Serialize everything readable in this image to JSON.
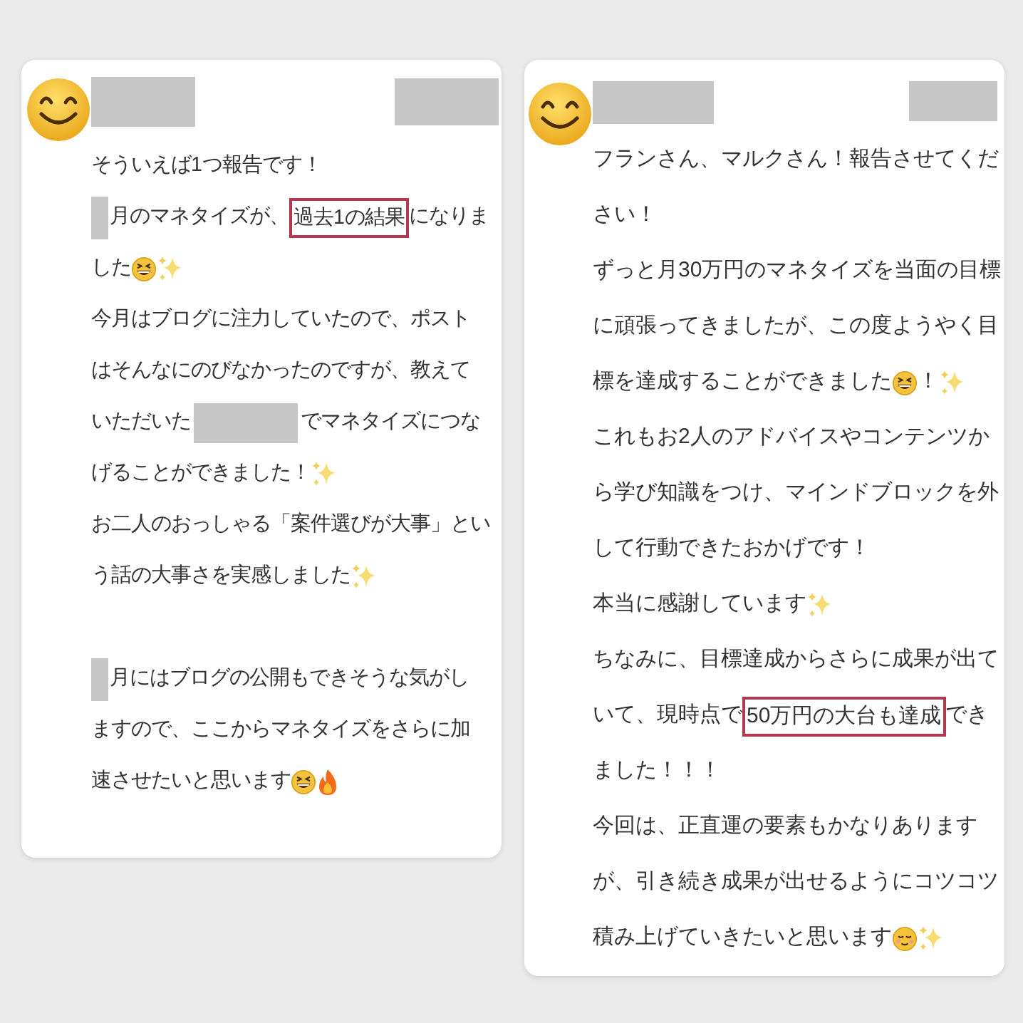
{
  "cards": [
    {
      "lines": [
        {
          "kind": "line",
          "segments": [
            {
              "kind": "text",
              "text": "そういえば1つ報告です！"
            }
          ]
        },
        {
          "kind": "line",
          "segments": [
            {
              "kind": "redaction"
            },
            {
              "kind": "text",
              "text": "月のマネタイズが、"
            },
            {
              "kind": "highlight",
              "text": "過去1の結果"
            },
            {
              "kind": "text",
              "text": "になりま"
            }
          ]
        },
        {
          "kind": "line",
          "segments": [
            {
              "kind": "text",
              "text": "した"
            },
            {
              "kind": "grin"
            },
            {
              "kind": "sparkles"
            }
          ]
        },
        {
          "kind": "line",
          "segments": [
            {
              "kind": "text",
              "text": "今月はブログに注力していたので、ポスト"
            }
          ]
        },
        {
          "kind": "line",
          "segments": [
            {
              "kind": "text",
              "text": "はそんなにのびなかったのですが、教えて"
            }
          ]
        },
        {
          "kind": "line",
          "segments": [
            {
              "kind": "text",
              "text": "いただいた"
            },
            {
              "kind": "redaction"
            },
            {
              "kind": "text",
              "text": "でマネタイズにつな"
            }
          ]
        },
        {
          "kind": "line",
          "segments": [
            {
              "kind": "text",
              "text": "げることができました！"
            },
            {
              "kind": "sparkles"
            }
          ]
        },
        {
          "kind": "line",
          "segments": [
            {
              "kind": "text",
              "text": "お二人のおっしゃる「案件選びが大事」とい"
            }
          ]
        },
        {
          "kind": "line",
          "segments": [
            {
              "kind": "text",
              "text": "う話の大事さを実感しました"
            },
            {
              "kind": "sparkles"
            }
          ]
        },
        {
          "kind": "blank"
        },
        {
          "kind": "line",
          "segments": [
            {
              "kind": "redaction"
            },
            {
              "kind": "text",
              "text": "月にはブログの公開もできそうな気がし"
            }
          ]
        },
        {
          "kind": "line",
          "segments": [
            {
              "kind": "text",
              "text": "ますので、ここからマネタイズをさらに加"
            }
          ]
        },
        {
          "kind": "line",
          "segments": [
            {
              "kind": "text",
              "text": "速させたいと思います"
            },
            {
              "kind": "grin"
            },
            {
              "kind": "fire"
            }
          ]
        }
      ]
    },
    {
      "lines": [
        {
          "kind": "line",
          "segments": [
            {
              "kind": "text",
              "text": "フランさん、マルクさん！報告させてくだ"
            }
          ]
        },
        {
          "kind": "line",
          "segments": [
            {
              "kind": "text",
              "text": "さい！"
            }
          ]
        },
        {
          "kind": "line",
          "segments": [
            {
              "kind": "text",
              "text": "ずっと月30万円のマネタイズを当面の目標"
            }
          ]
        },
        {
          "kind": "line",
          "segments": [
            {
              "kind": "text",
              "text": "に頑張ってきましたが、この度ようやく目"
            }
          ]
        },
        {
          "kind": "line",
          "segments": [
            {
              "kind": "text",
              "text": "標を達成することができました"
            },
            {
              "kind": "grin"
            },
            {
              "kind": "text",
              "text": "！"
            },
            {
              "kind": "sparkles"
            }
          ]
        },
        {
          "kind": "line",
          "segments": [
            {
              "kind": "text",
              "text": "これもお2人のアドバイスやコンテンツか"
            }
          ]
        },
        {
          "kind": "line",
          "segments": [
            {
              "kind": "text",
              "text": "ら学び知識をつけ、マインドブロックを外"
            }
          ]
        },
        {
          "kind": "line",
          "segments": [
            {
              "kind": "text",
              "text": "して行動できたおかげです！"
            }
          ]
        },
        {
          "kind": "line",
          "segments": [
            {
              "kind": "text",
              "text": "本当に感謝しています"
            },
            {
              "kind": "sparkles"
            }
          ]
        },
        {
          "kind": "line",
          "segments": [
            {
              "kind": "text",
              "text": "ちなみに、目標達成からさらに成果が出て"
            }
          ]
        },
        {
          "kind": "line",
          "segments": [
            {
              "kind": "text",
              "text": "いて、現時点で"
            },
            {
              "kind": "highlight",
              "text": "50万円の大台も達成"
            },
            {
              "kind": "text",
              "text": "でき"
            }
          ]
        },
        {
          "kind": "line",
          "segments": [
            {
              "kind": "text",
              "text": "ました！！！"
            }
          ]
        },
        {
          "kind": "line",
          "segments": [
            {
              "kind": "text",
              "text": "今回は、正直運の要素もかなりあります"
            }
          ]
        },
        {
          "kind": "line",
          "segments": [
            {
              "kind": "text",
              "text": "が、引き続き成果が出せるようにコツコツ"
            }
          ]
        },
        {
          "kind": "line",
          "segments": [
            {
              "kind": "text",
              "text": "積み上げていきたいと思います"
            },
            {
              "kind": "relieved"
            },
            {
              "kind": "sparkles"
            }
          ]
        }
      ]
    }
  ]
}
